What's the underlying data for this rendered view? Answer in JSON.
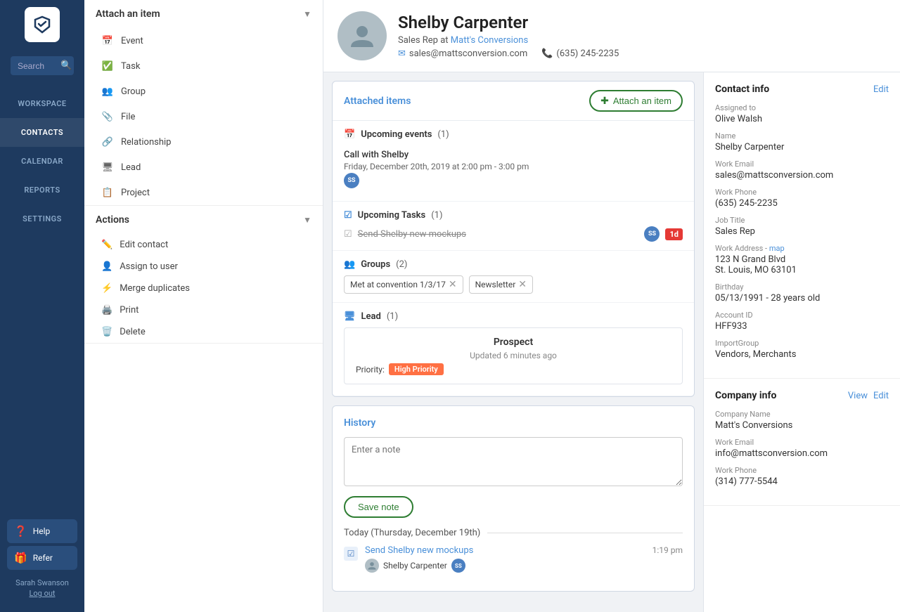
{
  "sidebar": {
    "logo_alt": "App logo",
    "search_placeholder": "Search",
    "search_icon": "🔍",
    "nav_items": [
      {
        "id": "workspace",
        "label": "WORKSPACE",
        "active": false
      },
      {
        "id": "contacts",
        "label": "CONTACTS",
        "active": true
      },
      {
        "id": "calendar",
        "label": "CALENDAR",
        "active": false
      },
      {
        "id": "reports",
        "label": "REPORTS",
        "active": false
      },
      {
        "id": "settings",
        "label": "SETTINGS",
        "active": false
      }
    ],
    "help_label": "Help",
    "refer_label": "Refer",
    "user_name": "Sarah Swanson",
    "logout_label": "Log out"
  },
  "panel": {
    "attach_header": "Attach an item",
    "items": [
      {
        "id": "event",
        "label": "Event",
        "icon": "calendar"
      },
      {
        "id": "task",
        "label": "Task",
        "icon": "check"
      },
      {
        "id": "group",
        "label": "Group",
        "icon": "group"
      },
      {
        "id": "file",
        "label": "File",
        "icon": "paperclip"
      },
      {
        "id": "relationship",
        "label": "Relationship",
        "icon": "link"
      },
      {
        "id": "lead",
        "label": "Lead",
        "icon": "monitor"
      },
      {
        "id": "project",
        "label": "Project",
        "icon": "clipboard"
      }
    ],
    "actions_header": "Actions",
    "actions": [
      {
        "id": "edit",
        "label": "Edit contact",
        "icon": "pencil"
      },
      {
        "id": "assign",
        "label": "Assign to user",
        "icon": "user-plus"
      },
      {
        "id": "merge",
        "label": "Merge duplicates",
        "icon": "merge"
      },
      {
        "id": "print",
        "label": "Print",
        "icon": "printer"
      },
      {
        "id": "delete",
        "label": "Delete",
        "icon": "trash"
      }
    ]
  },
  "profile": {
    "name": "Shelby Carpenter",
    "role": "Sales Rep at",
    "company": "Matt's Conversions",
    "email": "sales@mattsconversion.com",
    "phone": "(635) 245-2235"
  },
  "attached_items": {
    "title": "Attached items",
    "attach_btn_label": "Attach an item",
    "upcoming_events_label": "Upcoming events",
    "upcoming_events_count": "(1)",
    "event": {
      "title": "Call with Shelby",
      "date": "Friday, December 20th, 2019 at 2:00 pm - 3:00 pm",
      "badge": "SS"
    },
    "upcoming_tasks_label": "Upcoming Tasks",
    "upcoming_tasks_count": "(1)",
    "task": {
      "text": "Send Shelby new mockups",
      "badge1": "SS",
      "badge2": "1d"
    },
    "groups_label": "Groups",
    "groups_count": "(2)",
    "groups": [
      {
        "label": "Met at convention 1/3/17"
      },
      {
        "label": "Newsletter"
      }
    ],
    "lead_label": "Lead",
    "lead_count": "(1)",
    "lead": {
      "title": "Prospect",
      "updated": "Updated 6 minutes ago",
      "priority_label": "Priority:",
      "priority_value": "High Priority"
    }
  },
  "history": {
    "title": "History",
    "note_placeholder": "Enter a note",
    "save_note_label": "Save note",
    "date_label": "Today (Thursday, December 19th)",
    "entries": [
      {
        "id": "task-entry",
        "link_text": "Send Shelby new mockups",
        "person": "Shelby Carpenter",
        "person_badge": "SS",
        "time": "1:19 pm"
      }
    ]
  },
  "contact_info": {
    "title": "Contact info",
    "edit_label": "Edit",
    "assigned_to_label": "Assigned to",
    "assigned_to": "Olive Walsh",
    "name_label": "Name",
    "name": "Shelby Carpenter",
    "work_email_label": "Work Email",
    "work_email": "sales@mattsconversion.com",
    "work_phone_label": "Work Phone",
    "work_phone": "(635) 245-2235",
    "job_title_label": "Job Title",
    "job_title": "Sales Rep",
    "work_address_label": "Work Address",
    "map_label": "map",
    "address_line1": "123 N Grand Blvd",
    "address_line2": "St. Louis, MO 63101",
    "birthday_label": "Birthday",
    "birthday": "05/13/1991",
    "birthday_age": "- 28 years old",
    "account_id_label": "Account ID",
    "account_id": "HFF933",
    "import_group_label": "ImportGroup",
    "import_group": "Vendors, Merchants"
  },
  "company_info": {
    "title": "Company info",
    "view_label": "View",
    "edit_label": "Edit",
    "company_name_label": "Company Name",
    "company_name": "Matt's Conversions",
    "work_email_label": "Work Email",
    "work_email": "info@mattsconversion.com",
    "work_phone_label": "Work Phone",
    "work_phone": "(314) 777-5544"
  }
}
